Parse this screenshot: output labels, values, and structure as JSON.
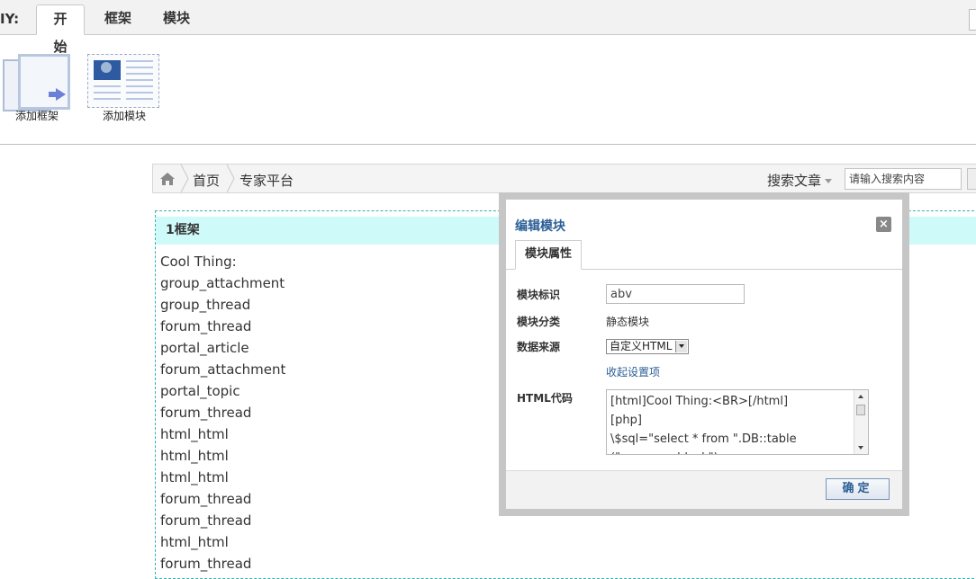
{
  "diy": {
    "label": "IY:",
    "tabs": [
      {
        "label": "开始",
        "active": true
      },
      {
        "label": "框架",
        "active": false
      },
      {
        "label": "模块",
        "active": false
      }
    ],
    "tools": [
      {
        "label": "添加框架",
        "icon": "add-frame-icon"
      },
      {
        "label": "添加模块",
        "icon": "add-module-icon"
      }
    ]
  },
  "breadcrumb": {
    "items": [
      "首页",
      "专家平台"
    ],
    "home_icon": "home-icon"
  },
  "search": {
    "type_label": "搜索文章",
    "placeholder": "请输入搜索内容"
  },
  "frame": {
    "title": "1框架",
    "items": [
      "Cool Thing:",
      "group_attachment",
      "group_thread",
      "forum_thread",
      "portal_article",
      "forum_attachment",
      "portal_topic",
      "forum_thread",
      "html_html",
      "html_html",
      "html_html",
      "forum_thread",
      "forum_thread",
      "html_html",
      "forum_thread"
    ]
  },
  "dialog": {
    "title": "编辑模块",
    "tab_label": "模块属性",
    "fields": {
      "id_label": "模块标识",
      "id_value": "abv",
      "category_label": "模块分类",
      "category_value": "静态模块",
      "source_label": "数据来源",
      "source_value": "自定义HTML",
      "collapse_link": "收起设置项",
      "html_label": "HTML代码",
      "html_value": "[html]Cool Thing:<BR>[/html]\n[php]\n\\$sql=\"select * from \".DB::table\n(\"common_block\")."
    },
    "ok_label": "确定",
    "colors": {
      "title": "#2b5f96",
      "frame_highlight": "#cffafa"
    }
  }
}
